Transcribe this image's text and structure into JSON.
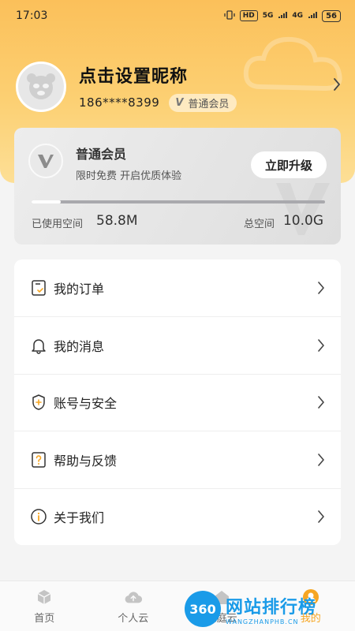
{
  "status_bar": {
    "time": "17:03",
    "hd": "HD",
    "network_1": "5G",
    "network_2": "4G",
    "battery": "56"
  },
  "profile": {
    "nickname": "点击设置昵称",
    "phone": "186****8399",
    "member_badge": "普通会员",
    "badge_letter": "V"
  },
  "member_card": {
    "title": "普通会员",
    "subtitle": "限时免费 开启优质体验",
    "upgrade_button": "立即升级",
    "used_label": "已使用空间",
    "used_value": "58.8M",
    "total_label": "总空间",
    "total_value": "10.0G",
    "usage_fraction": 0.1
  },
  "menu": {
    "items": [
      {
        "label": "我的订单",
        "icon": "order-icon"
      },
      {
        "label": "我的消息",
        "icon": "bell-icon"
      },
      {
        "label": "账号与安全",
        "icon": "shield-icon"
      },
      {
        "label": "帮助与反馈",
        "icon": "help-icon"
      },
      {
        "label": "关于我们",
        "icon": "info-icon"
      }
    ]
  },
  "tabbar": {
    "tabs": [
      {
        "label": "首页",
        "icon": "home-cube-icon"
      },
      {
        "label": "个人云",
        "icon": "cloud-upload-icon"
      },
      {
        "label": "家庭云",
        "icon": "family-cloud-icon"
      },
      {
        "label": "我的",
        "icon": "user-icon"
      }
    ],
    "active_color": "#f6a623"
  },
  "watermark": {
    "badge": "360",
    "title": "网站排行榜",
    "subtitle": "WANGZHANPHB.CN"
  },
  "colors": {
    "hero": "#fcd073",
    "accent": "#f6a623"
  }
}
